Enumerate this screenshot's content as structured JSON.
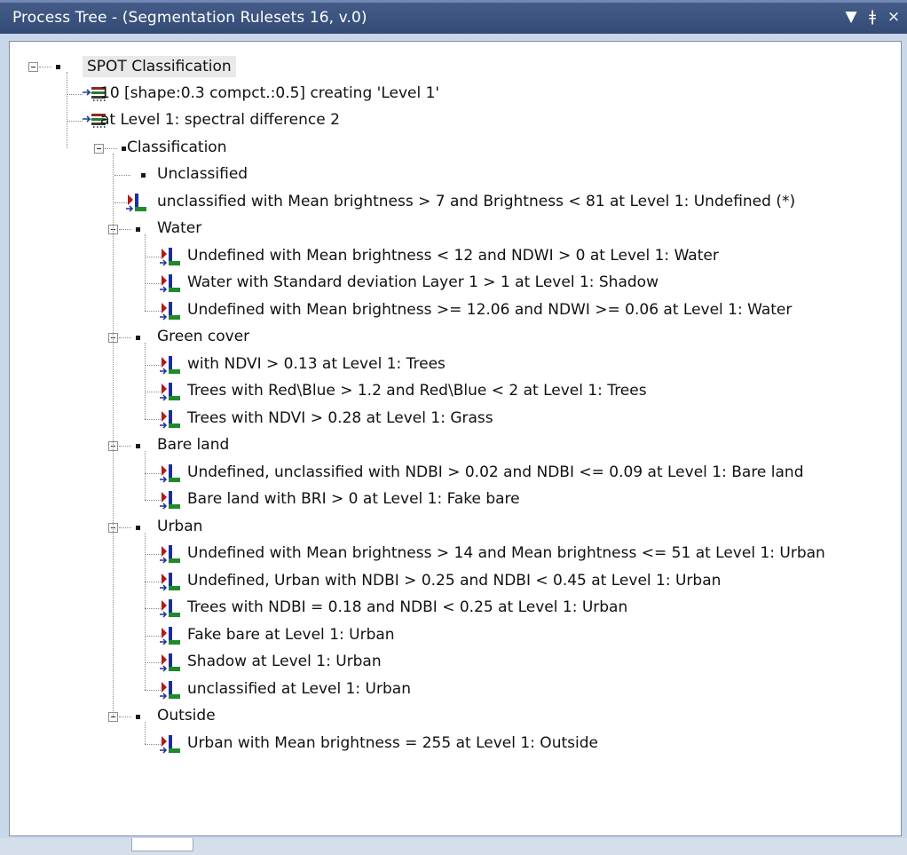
{
  "window": {
    "title": "Process Tree - (Segmentation Rulesets 16, v.0)",
    "controls": {
      "dropdown": "▼",
      "pin": "ǂ",
      "close": "×"
    }
  },
  "tree": {
    "root": "SPOT Classification",
    "root_steps": [
      "10 [shape:0.3 compct.:0.5] creating 'Level 1'",
      "at  Level 1: spectral difference 2"
    ],
    "classification": "Classification",
    "groups": [
      {
        "label": "Unclassified",
        "expandable": false,
        "rules": []
      },
      {
        "label": null,
        "rules": [
          "unclassified with Mean brightness > 7  and Brightness < 81  at  Level 1: Undefined (*)"
        ]
      },
      {
        "label": "Water",
        "expandable": true,
        "rules": [
          "Undefined with Mean brightness < 12  and NDWI > 0  at  Level 1: Water",
          "Water with Standard deviation Layer 1 > 1  at  Level 1: Shadow",
          "Undefined with Mean brightness >= 12.06  and NDWI >= 0.06  at  Level 1: Water"
        ]
      },
      {
        "label": "Green cover",
        "expandable": true,
        "rules": [
          "with NDVI > 0.13  at  Level 1: Trees",
          "Trees with Red\\Blue > 1.2  and Red\\Blue < 2  at  Level 1: Trees",
          "Trees with NDVI > 0.28  at  Level 1: Grass"
        ]
      },
      {
        "label": "Bare land",
        "expandable": true,
        "rules": [
          "Undefined, unclassified with NDBI > 0.02  and NDBI <= 0.09  at  Level 1: Bare land",
          "Bare land with BRI > 0  at  Level 1: Fake bare"
        ]
      },
      {
        "label": "Urban",
        "expandable": true,
        "rules": [
          "Undefined with Mean brightness > 14  and Mean brightness <= 51  at  Level 1: Urban",
          "Undefined, Urban with NDBI > 0.25  and NDBI < 0.45  at  Level 1: Urban",
          "Trees with NDBI = 0.18  and NDBI < 0.25  at  Level 1: Urban",
          "Fake bare at  Level 1: Urban",
          "Shadow at  Level 1: Urban",
          "unclassified at  Level 1: Urban"
        ]
      },
      {
        "label": "Outside",
        "expandable": true,
        "rules": [
          "Urban with Mean brightness = 255  at  Level 1: Outside"
        ]
      }
    ]
  },
  "icons": {
    "segmentation_step": "segmentation-icon",
    "assign_class_rule": "classify-icon"
  },
  "colors": {
    "titlebar": "#3c5480",
    "panel_bg": "#ffffff",
    "selection": "#e9e9e9"
  }
}
